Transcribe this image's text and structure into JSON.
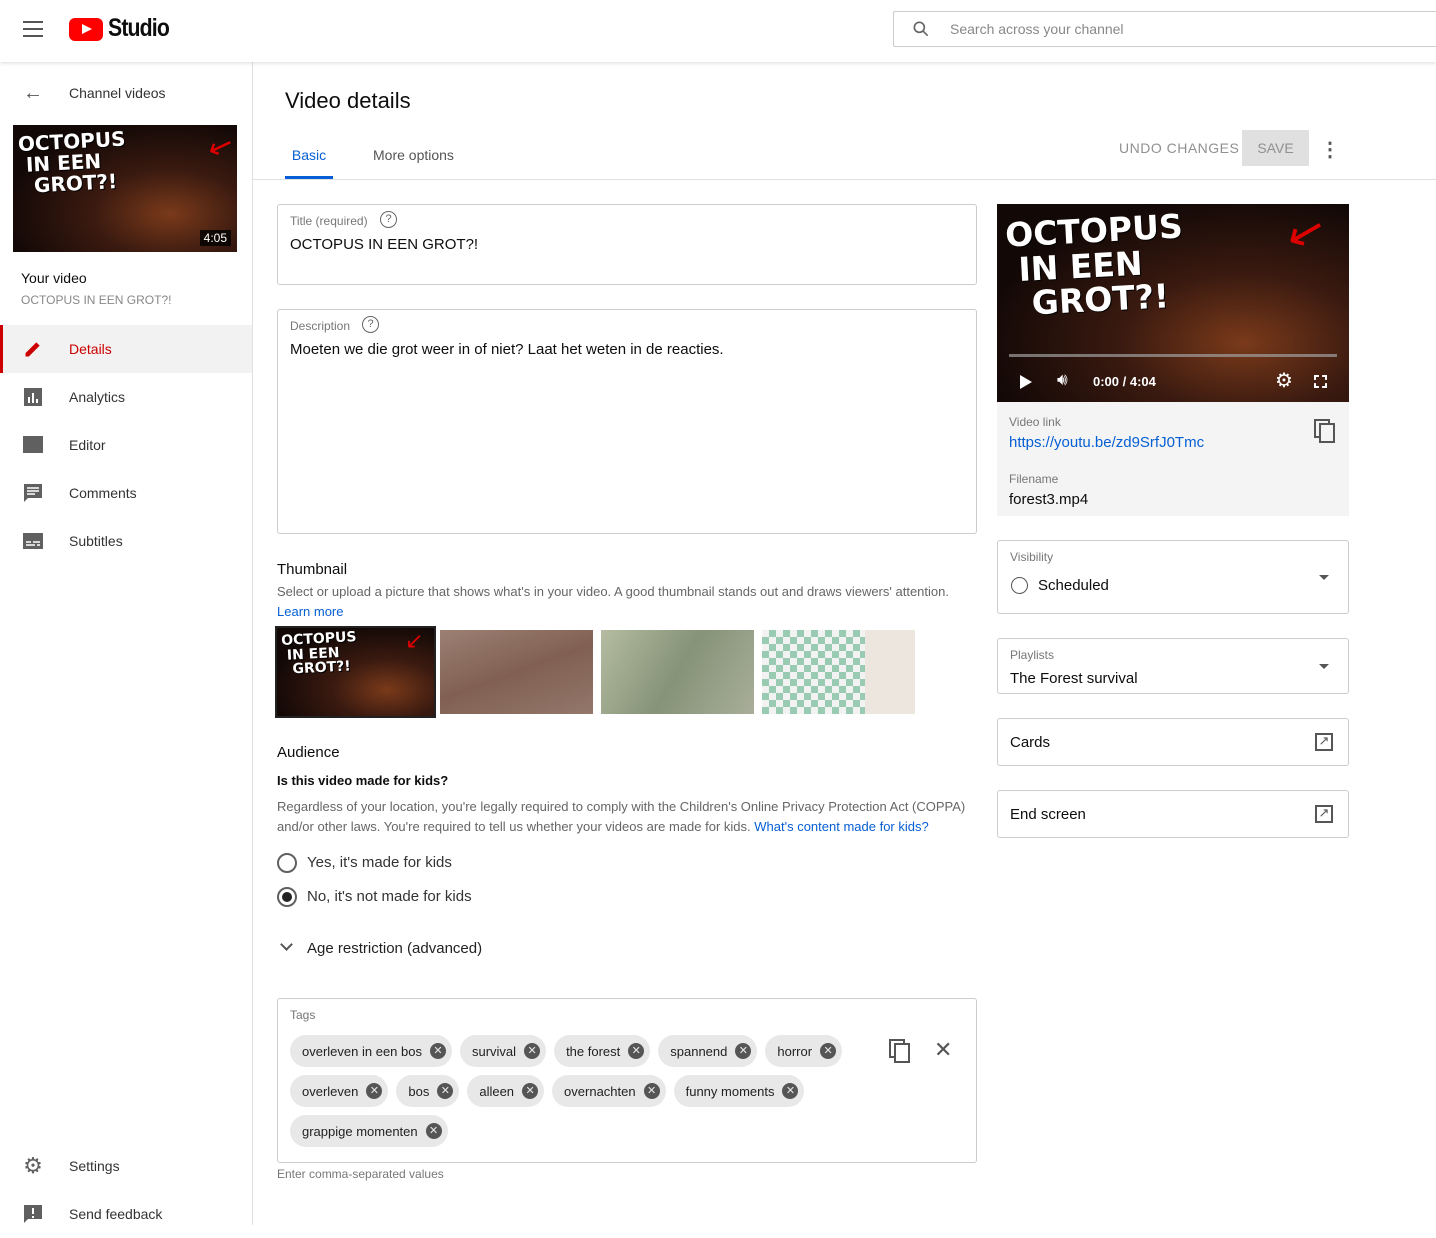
{
  "header": {
    "logo_text": "Studio",
    "search_placeholder": "Search across your channel"
  },
  "sidebar": {
    "back_label": "Channel videos",
    "thumb_title": "OCTOPUS IN EEN GROT?!",
    "thumb_duration": "4:05",
    "your_video_label": "Your video",
    "video_title": "OCTOPUS IN EEN GROT?!",
    "items": [
      {
        "label": "Details",
        "icon": "pencil-icon"
      },
      {
        "label": "Analytics",
        "icon": "analytics-icon"
      },
      {
        "label": "Editor",
        "icon": "clapperboard-icon"
      },
      {
        "label": "Comments",
        "icon": "comment-icon"
      },
      {
        "label": "Subtitles",
        "icon": "subtitles-icon"
      }
    ],
    "bottom": [
      {
        "label": "Settings",
        "icon": "gear-icon"
      },
      {
        "label": "Send feedback",
        "icon": "feedback-icon"
      }
    ]
  },
  "main": {
    "page_title": "Video details",
    "tabs": [
      {
        "label": "Basic"
      },
      {
        "label": "More options"
      }
    ],
    "undo_label": "UNDO CHANGES",
    "save_label": "SAVE",
    "title_label": "Title (required)",
    "title_value": "OCTOPUS IN EEN GROT?!",
    "description_label": "Description",
    "description_value": "Moeten we die grot weer in of niet? Laat het weten in de reacties.",
    "thumbnail": {
      "heading": "Thumbnail",
      "help": "Select or upload a picture that shows what's in your video. A good thumbnail stands out and draws viewers' attention.",
      "learn_more": "Learn more",
      "main_title": "OCTOPUS IN EEN GROT?!"
    },
    "audience": {
      "heading": "Audience",
      "question": "Is this video made for kids?",
      "help": "Regardless of your location, you're legally required to comply with the Children's Online Privacy Protection Act (COPPA) and/or other laws. You're required to tell us whether your videos are made for kids.",
      "help_link": "What's content made for kids?",
      "yes": "Yes, it's made for kids",
      "no": "No, it's not made for kids",
      "selected": "no"
    },
    "age_restriction": "Age restriction (advanced)",
    "tags": {
      "label": "Tags",
      "items": [
        "overleven in een bos",
        "survival",
        "the forest",
        "spannend",
        "horror",
        "overleven",
        "bos",
        "alleen",
        "overnachten",
        "funny moments",
        "grappige momenten"
      ],
      "hint": "Enter comma-separated values"
    }
  },
  "right": {
    "player_title": "OCTOPUS IN EEN GROT?!",
    "time": "0:00 / 4:04",
    "video_link_label": "Video link",
    "video_link": "https://youtu.be/zd9SrfJ0Tmc",
    "filename_label": "Filename",
    "filename": "forest3.mp4",
    "visibility_label": "Visibility",
    "visibility_value": "Scheduled",
    "playlists_label": "Playlists",
    "playlists_value": "The Forest survival",
    "cards_label": "Cards",
    "end_screen_label": "End screen"
  }
}
